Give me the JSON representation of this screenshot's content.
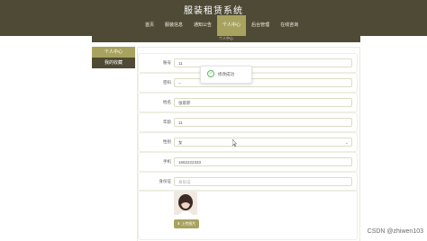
{
  "header": {
    "site_title": "服装租赁系统",
    "nav": [
      "首页",
      "服装信息",
      "通知公告",
      "个人中心",
      "后台管理",
      "在线咨询"
    ],
    "active_index": 3
  },
  "breadcrumb": "个人中心",
  "sidebar": {
    "title": "个人中心",
    "items": [
      "我的收藏"
    ]
  },
  "form": {
    "fields": [
      {
        "label": "账号",
        "value": "11"
      },
      {
        "label": "密码",
        "value": "--"
      },
      {
        "label": "姓名",
        "value": "张雨菲"
      },
      {
        "label": "年龄",
        "value": "11"
      },
      {
        "label": "性别",
        "value": "女",
        "type": "select"
      },
      {
        "label": "手机",
        "value": "1662222333"
      },
      {
        "label": "身份证",
        "value": "身份证"
      }
    ],
    "upload_label": "上传图片"
  },
  "toast": {
    "message": "修改成功"
  },
  "watermark": "CSDN @zhiwen103",
  "colors": {
    "header": "#4e4a35",
    "accent": "#a7a35f",
    "success": "#5cb85c"
  }
}
